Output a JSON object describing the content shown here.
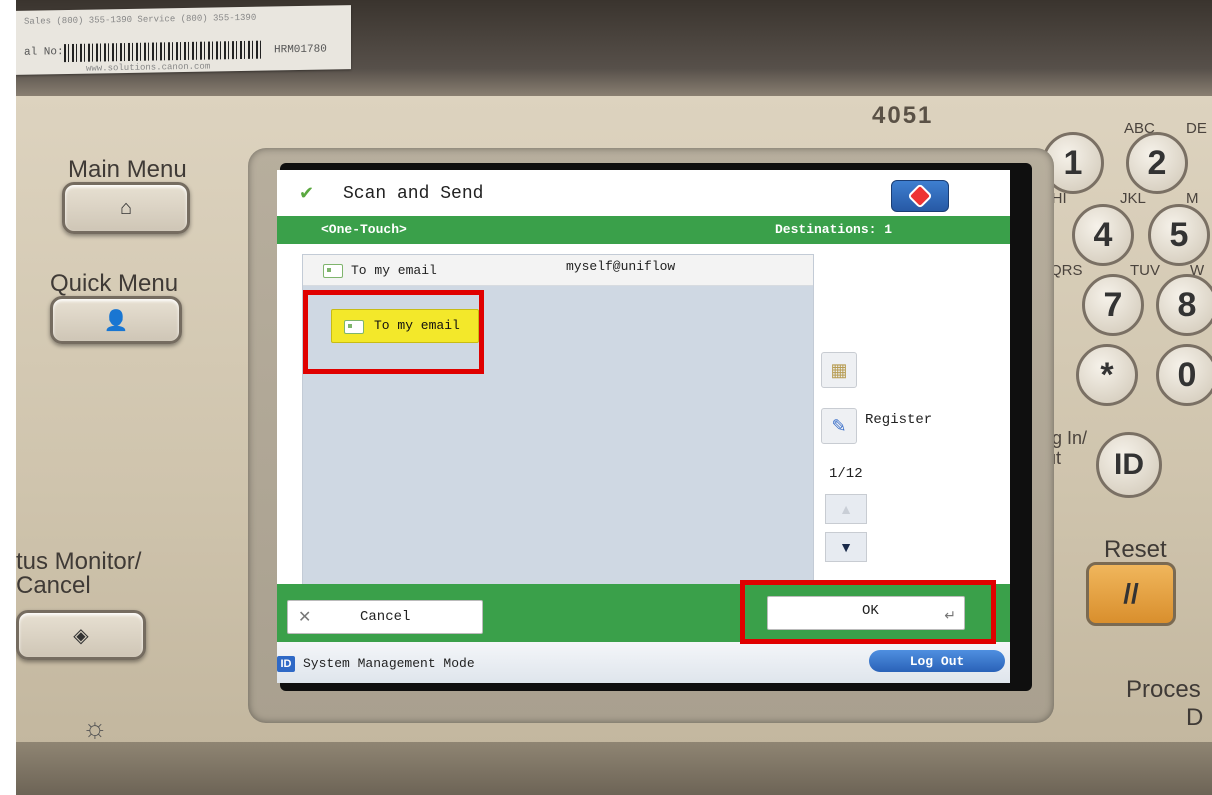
{
  "device": {
    "model": "4051",
    "sticker_line1": "Sales (800) 355-1390  Service (800) 355-1390",
    "sticker_label_prefix": "al No:",
    "sticker_serial": "HRM01780",
    "sticker_url": "www.solutions.canon.com",
    "main_menu_label": "Main Menu",
    "quick_menu_label": "Quick Menu",
    "status_monitor_label": "tus Monitor/\nCancel",
    "login_label": "Log In/\nOut",
    "id_key": "ID",
    "reset_label": "Reset",
    "reset_key": "//",
    "process_label": "Proces",
    "process_label2": "D"
  },
  "keypad": {
    "keys": [
      "1",
      "2",
      "4",
      "5",
      "7",
      "8",
      "*",
      "0"
    ],
    "letters": [
      "ABC",
      "DE",
      "GHI",
      "JKL",
      "M",
      "PQRS",
      "TUV",
      "W"
    ]
  },
  "screen": {
    "title": "Scan and Send",
    "section": "<One-Touch>",
    "destinations": "Destinations: 1",
    "list_header": {
      "name": "To my email",
      "address": "myself@uniflow"
    },
    "one_touch_button": "To my email",
    "register_label": "Register",
    "page_indicator": "1/12",
    "cancel_label": "Cancel",
    "ok_label": "OK",
    "mode_label": "System Management Mode",
    "logout_label": "Log Out"
  },
  "colors": {
    "green": "#3aa04a",
    "highlight": "#e00000",
    "one_touch_yellow": "#f3e82a"
  }
}
